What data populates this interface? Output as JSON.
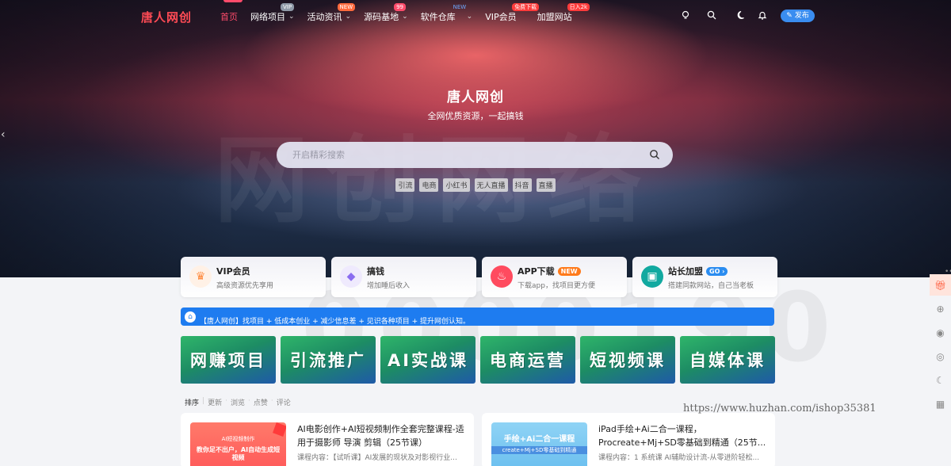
{
  "header": {
    "logo": "唐人网创",
    "menu": [
      {
        "label": "首页",
        "active": true,
        "chevron": false,
        "badge": ""
      },
      {
        "label": "网络项目",
        "active": false,
        "chevron": true,
        "badge": "VIP",
        "badge_color": "#8f9aa8"
      },
      {
        "label": "活动资讯",
        "active": false,
        "chevron": true,
        "badge": "NEW",
        "badge_color": "#ff6a3d"
      },
      {
        "label": "源码基地",
        "active": false,
        "chevron": true,
        "badge": "99",
        "badge_color": "#ff4b6b"
      },
      {
        "label": "软件仓库",
        "active": false,
        "chevron": true,
        "badge": "NEW",
        "badge_color": "#3a8df0"
      },
      {
        "label": "VIP会员",
        "active": false,
        "chevron": false,
        "badge": "免费下载",
        "badge_color": "#ff3b3b"
      },
      {
        "label": "加盟网站",
        "active": false,
        "chevron": false,
        "badge": "日入2k",
        "badge_color": "#ff3b3b"
      }
    ],
    "icons": [
      "lightbulb-icon",
      "search-icon",
      "moon-icon",
      "bell-icon"
    ],
    "publish_label": "发布"
  },
  "hero": {
    "title": "唐人网创",
    "subtitle": "全网优质资源，一起搞钱",
    "search_placeholder": "开启精彩搜索",
    "tags": [
      "引流",
      "电商",
      "小红书",
      "无人直播",
      "抖音",
      "直播"
    ]
  },
  "features": [
    {
      "title": "VIP会员",
      "desc": "高级资源优先享用",
      "badge": "",
      "icon": "crown-icon",
      "icon_color": "#ff8a3d",
      "icon_bg": "#fff1e6"
    },
    {
      "title": "搞钱",
      "desc": "增加睡后收入",
      "badge": "",
      "icon": "diamond-icon",
      "icon_color": "#8a6cf0",
      "icon_bg": "#efeafd"
    },
    {
      "title": "APP下载",
      "desc": "下载app，找项目更方便",
      "badge": "NEW",
      "badge_color": "#ff7a1a",
      "icon": "flame-icon",
      "icon_color": "#ffffff",
      "icon_bg": "#ff4b5f"
    },
    {
      "title": "站长加盟",
      "desc": "搭建同款网站，自己当老板",
      "badge": "GO",
      "badge_color": "#2a8cf0",
      "icon": "store-icon",
      "icon_color": "#ffffff",
      "icon_bg": "#12a9a0"
    }
  ],
  "notice": "【唐人网创】找项目 + 低成本创业 + 减少信息差 + 见识各种项目 + 提升网创认知。",
  "categories": [
    "网赚项目",
    "引流推广",
    "AI实战课",
    "电商运营",
    "短视频课",
    "自媒体课"
  ],
  "sort": {
    "label": "排序",
    "options": [
      "更新",
      "浏览",
      "点赞",
      "评论"
    ]
  },
  "posts": [
    {
      "title": "AI电影创作+AI短视频制作全套完整课程-适用于摄影师 导演 剪辑（25节课）",
      "meta": "课程内容：【试听课】AI发展的现状及对影视行业...",
      "thumb_caption": "AI短视频制作",
      "thumb_text": "教你足不出户，AI自动生成短视频"
    },
    {
      "title": "iPad手绘+Ai二合一课程，Procreate+Mj+SD零基础到精通（25节...",
      "meta": "课程内容：1 系统课 AI辅助设计流-从零进阶轻松...",
      "thumb_caption": "手绘+Ai二合一课程",
      "thumb_text": "create+Mj+SD零基础到精通"
    }
  ],
  "floatbar": [
    "gift-icon",
    "plus-circle-icon",
    "qq-icon",
    "wechat-icon",
    "moon-icon",
    "qrcode-icon"
  ],
  "site_watermark": "https://www.huzhan.com/ishop35381"
}
